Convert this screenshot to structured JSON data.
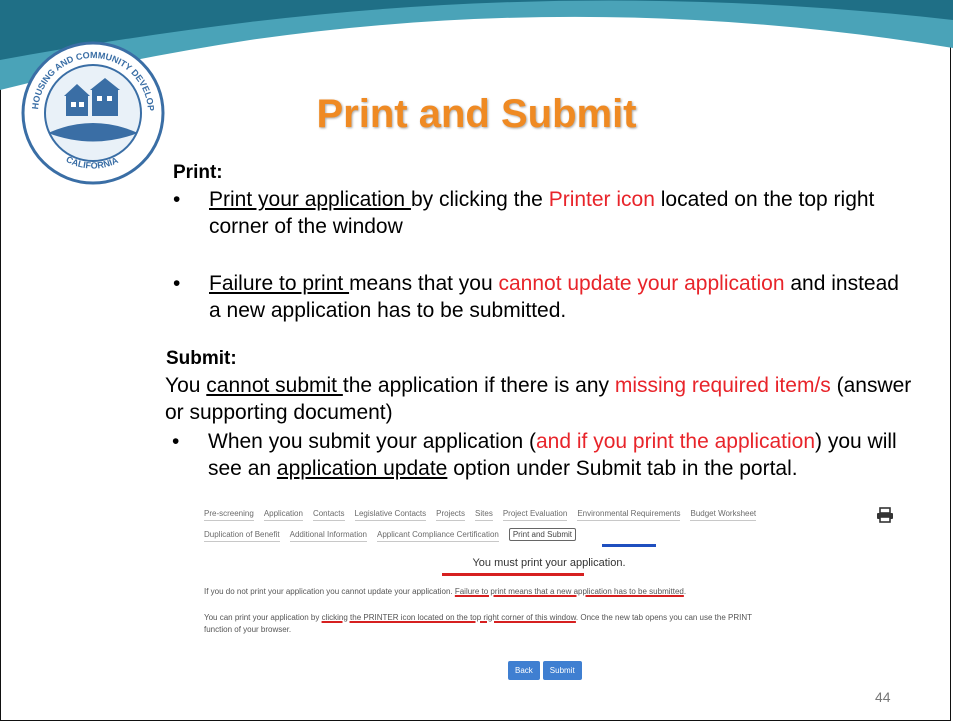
{
  "slide": {
    "title": "Print and Submit",
    "page_number": "44"
  },
  "logo": {
    "seal_text": [
      "HOUSING AND COMMUNITY DEVELOPMENT",
      "CALIFORNIA"
    ]
  },
  "print_section": {
    "heading": "Print:",
    "bullet1": {
      "underlined": "Print your application ",
      "text1": "by clicking the ",
      "red": "Printer icon",
      "text2": " located on the top right corner of the window"
    },
    "bullet2": {
      "underlined": "Failure to print ",
      "text1": "means that you ",
      "red": "cannot update your application",
      "text2": " and instead a new application has to be submitted."
    }
  },
  "submit_section": {
    "heading": "Submit:",
    "para": {
      "text1": "You ",
      "underlined": "cannot submit ",
      "text2": "the application if there is any ",
      "red": "missing required item/s",
      "text3": " (answer or supporting document)"
    },
    "bullet": {
      "text1": "When you submit your application (",
      "red": "and if you print the application",
      "text2": ") you will see an ",
      "underlined": "application update",
      "text3": " option under Submit tab in the portal."
    }
  },
  "portal": {
    "tabs_row1": [
      "Pre-screening",
      "Application",
      "Contacts",
      "Legislative Contacts",
      "Projects",
      "Sites",
      "Project Evaluation",
      "Environmental Requirements",
      "Budget Worksheet"
    ],
    "tabs_row2": [
      "Duplication of Benefit",
      "Additional Information",
      "Applicant Compliance Certification",
      "Print and Submit"
    ],
    "active_tab": "Print and Submit",
    "printer_icon": "printer-icon",
    "must_print": "You must print your application.",
    "line1_text": "If you do not print your application you cannot update your application. ",
    "line1_red": "Failure to print  means that a new application has to be submitted",
    "line1_end": ".",
    "line2_text": "You can print your application by ",
    "line2_red": "clicking the PRINTER icon located on the top right corner of this window",
    "line2_end": ". Once the new tab opens you can use the PRINT",
    "line3": "function of your browser.",
    "back_button": "Back",
    "submit_button": "Submit"
  },
  "colors": {
    "title": "#ef8a23",
    "highlight_red": "#e8242a",
    "banner_teal": "#4aa3b8",
    "button_blue": "#3f7fd1"
  }
}
